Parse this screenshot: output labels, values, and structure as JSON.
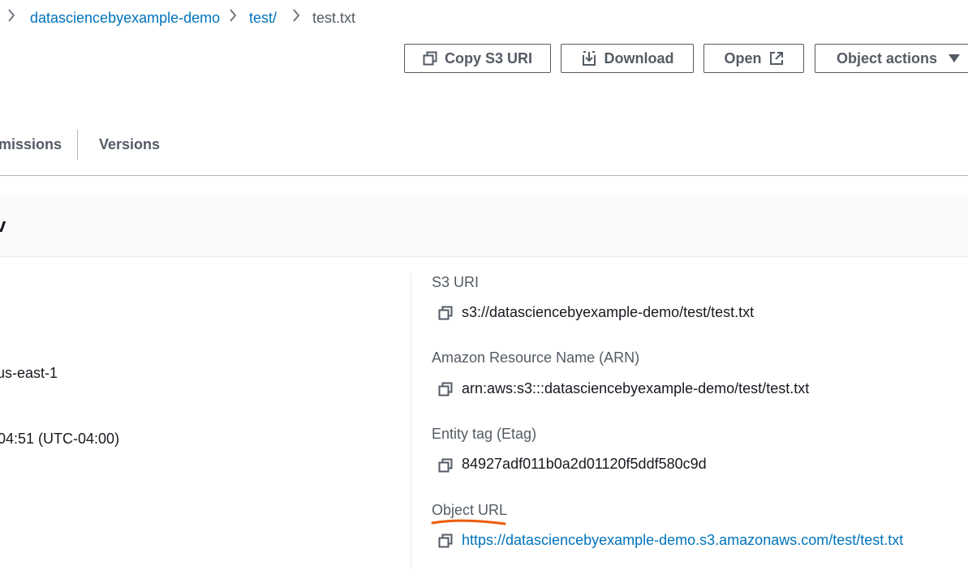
{
  "breadcrumb": {
    "items": [
      {
        "label": "datasciencebyexample-demo",
        "link": true
      },
      {
        "label": "test/",
        "link": true
      },
      {
        "label": "test.txt",
        "link": false
      }
    ]
  },
  "toolbar": {
    "copy_s3_uri": "Copy S3 URI",
    "download": "Download",
    "open": "Open",
    "object_actions": "Object actions"
  },
  "tabs": {
    "permissions": "missions",
    "versions": "Versions"
  },
  "panel": {
    "title": "v"
  },
  "left_values": {
    "region": "us-east-1",
    "last_modified": "04:51 (UTC-04:00)"
  },
  "details": {
    "s3_uri": {
      "label": "S3 URI",
      "value": "s3://datasciencebyexample-demo/test/test.txt"
    },
    "arn": {
      "label": "Amazon Resource Name (ARN)",
      "value": "arn:aws:s3:::datasciencebyexample-demo/test/test.txt"
    },
    "etag": {
      "label": "Entity tag (Etag)",
      "value": "84927adf011b0a2d01120f5ddf580c9d"
    },
    "object_url": {
      "label": "Object URL",
      "value": "https://datasciencebyexample-demo.s3.amazonaws.com/test/test.txt"
    }
  },
  "colors": {
    "link": "#0073bb",
    "annotation": "#ec5b0a",
    "border": "#545b64"
  },
  "icons": [
    "chevron-right-icon",
    "copy-icon",
    "download-icon",
    "external-link-icon",
    "caret-down-icon"
  ]
}
